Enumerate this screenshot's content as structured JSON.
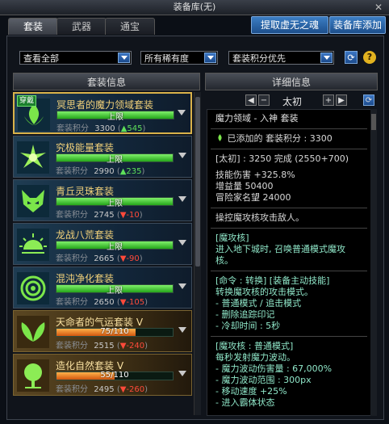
{
  "window": {
    "title": "装备库(无)"
  },
  "tabs": [
    {
      "label": "套装",
      "active": true
    },
    {
      "label": "武器",
      "active": false
    },
    {
      "label": "通宝",
      "active": false
    }
  ],
  "top_buttons": {
    "extract": "提取虚无之魂",
    "add": "装备库添加"
  },
  "filters": {
    "scope": "查看全部",
    "rarity": "所有稀有度",
    "sort": "套装积分优先"
  },
  "left_panel": {
    "header": "套装信息"
  },
  "right_panel": {
    "header": "详细信息",
    "level_name": "太初"
  },
  "score_label": "套装积分",
  "sets": [
    {
      "name": "冥思者的魔力领域套装",
      "bar_text": "上限",
      "fill": 1.0,
      "score": "3300",
      "delta": "▲545",
      "delta_dir": "up",
      "style": "blue",
      "selected": true,
      "badge": "穿戴",
      "icon": "flame-lotus-icon"
    },
    {
      "name": "究极能量套装",
      "bar_text": "上限",
      "fill": 1.0,
      "score": "2990",
      "delta": "▲235",
      "delta_dir": "up",
      "style": "blue",
      "icon": "starburst-icon"
    },
    {
      "name": "青丘灵珠套装",
      "bar_text": "上限",
      "fill": 1.0,
      "score": "2745",
      "delta": "▼-10",
      "delta_dir": "down",
      "style": "blue",
      "icon": "fox-mask-icon"
    },
    {
      "name": "龙战八荒套装",
      "bar_text": "上限",
      "fill": 1.0,
      "score": "2665",
      "delta": "▼-90",
      "delta_dir": "down",
      "style": "blue",
      "icon": "rising-sun-icon"
    },
    {
      "name": "混沌净化套装",
      "bar_text": "上限",
      "fill": 1.0,
      "score": "2650",
      "delta": "▼-105",
      "delta_dir": "down",
      "style": "blue",
      "icon": "rose-icon"
    },
    {
      "name": "天命者的气运套装 Ⅴ",
      "bar_text": "75/110",
      "fill": 0.68,
      "score": "2515",
      "delta": "▼-240",
      "delta_dir": "down",
      "style": "gold",
      "icon": "leaf-wings-icon"
    },
    {
      "name": "造化自然套装 Ⅴ",
      "bar_text": "55/110",
      "fill": 0.5,
      "score": "2495",
      "delta": "▼-260",
      "delta_dir": "down",
      "style": "gold",
      "icon": "tree-icon"
    }
  ],
  "detail": {
    "line1": "魔力领域 - 入神 套装",
    "line2": "已添加的 套装积分 : 3300",
    "line3": "[太初] : 3250 完成 (2550+700)",
    "stat1": "技能伤害 +325.8%",
    "stat2": "增益量 50400",
    "stat3": "冒险家名望 24000",
    "desc": "操控魔攻核攻击敌人。",
    "s1_title": "[魔攻核]",
    "s1_l1": "进入地下城时, 召唤普通模式魔攻",
    "s1_l2": "核。",
    "s2_title": "[命令 : 转换] [装备主动技能]",
    "s2_l1": "转换魔攻核的攻击模式。",
    "s2_l2": "- 普通模式 / 追击模式",
    "s2_l3": "- 删除追踪印记",
    "s2_l4": "- 冷却时间 : 5秒",
    "s3_title": "[魔攻核 : 普通模式]",
    "s3_l1": "每秒发射魔力波动。",
    "s3_l2": "- 魔力波动伤害量 : 67,000%",
    "s3_l3": "- 魔力波动范围 : 300px",
    "s3_l4": "- 移动速度 +25%",
    "s3_l5": "- 进入霸体状态"
  }
}
